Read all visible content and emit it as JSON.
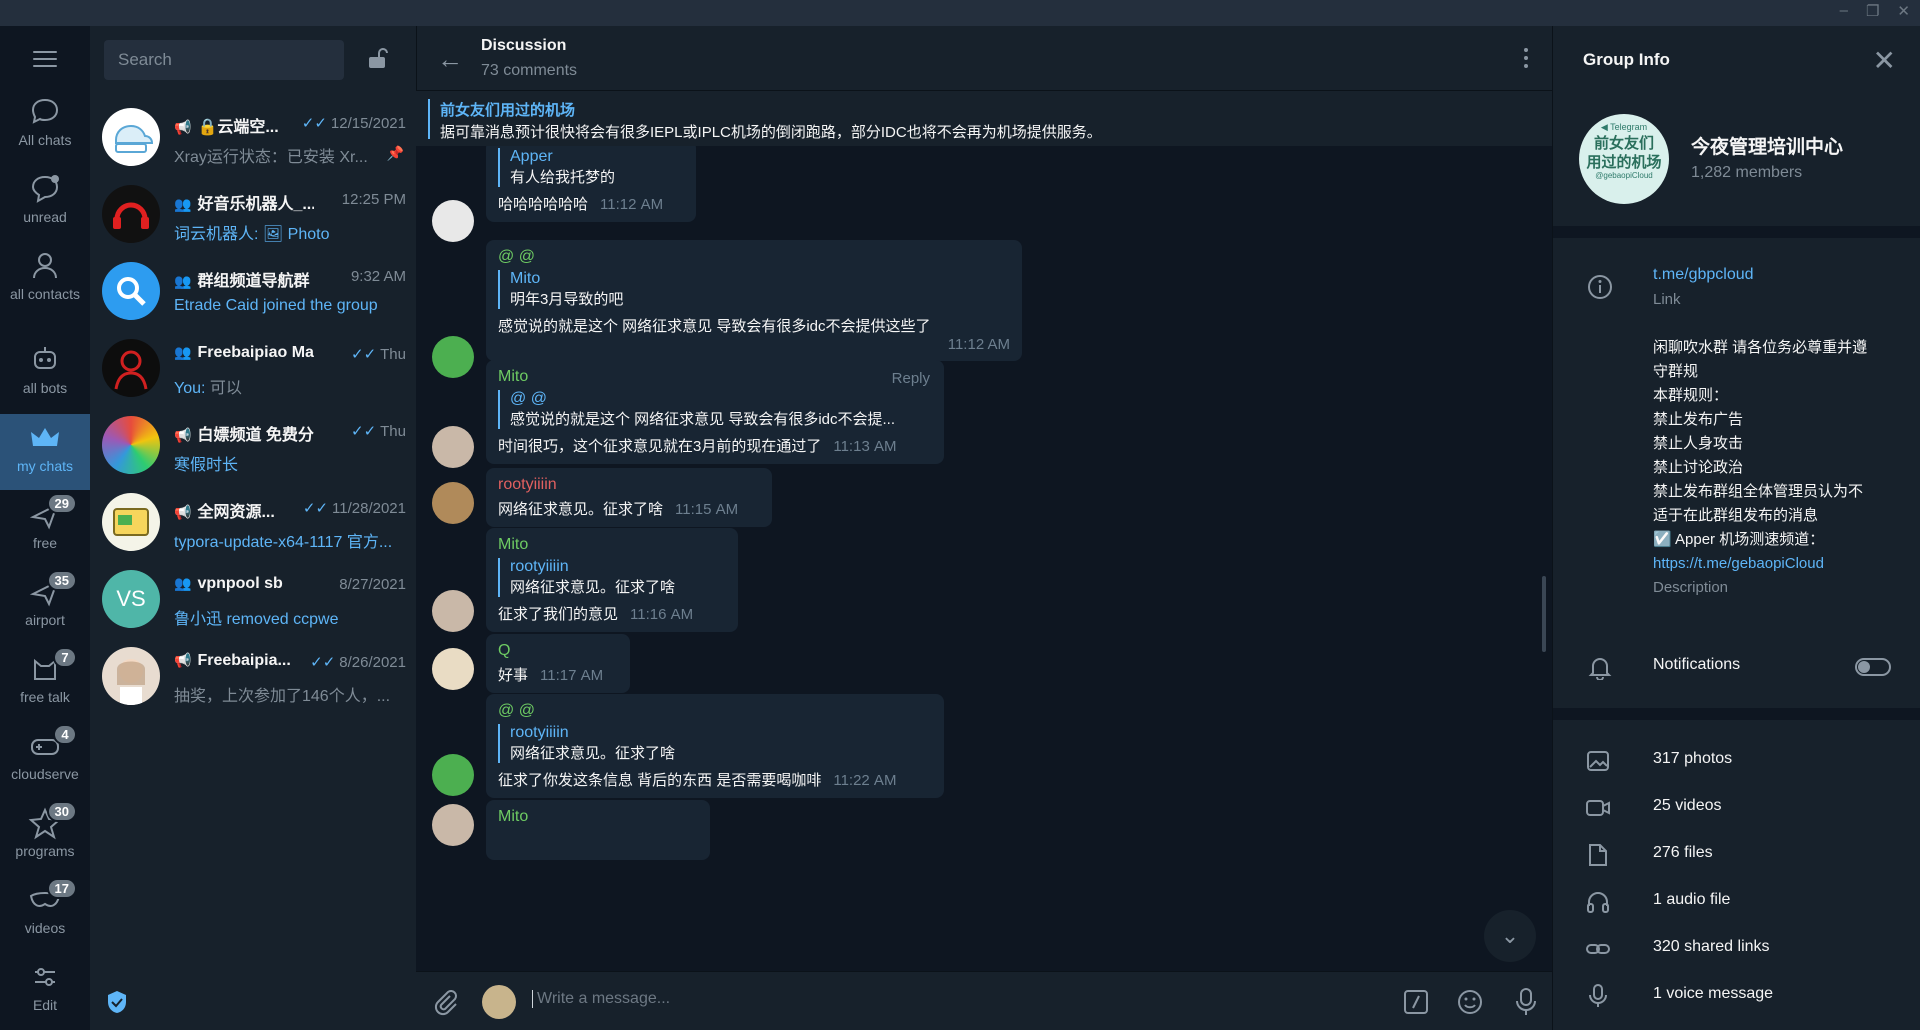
{
  "window": {
    "minimize": "–",
    "restore": "❐",
    "close": "✕"
  },
  "folders": [
    {
      "label": "All chats",
      "icon": "chat-bubbles-icon",
      "badge": ""
    },
    {
      "label": "unread",
      "icon": "chat-bubble-icon",
      "badge": ""
    },
    {
      "label": "all contacts",
      "icon": "person-icon",
      "badge": ""
    },
    {
      "label": "all bots",
      "icon": "bot-icon",
      "badge": ""
    },
    {
      "label": "my chats",
      "icon": "crown-icon",
      "badge": ""
    },
    {
      "label": "free",
      "icon": "plane-icon",
      "badge": "29"
    },
    {
      "label": "airport",
      "icon": "plane-icon",
      "badge": "35"
    },
    {
      "label": "free talk",
      "icon": "cat-icon",
      "badge": "7"
    },
    {
      "label": "cloudserve",
      "icon": "gamepad-icon",
      "badge": "4"
    },
    {
      "label": "programs",
      "icon": "star-icon",
      "badge": "30"
    },
    {
      "label": "videos",
      "icon": "mask-icon",
      "badge": "17"
    },
    {
      "label": "Edit",
      "icon": "sliders-icon",
      "badge": ""
    }
  ],
  "search": {
    "placeholder": "Search"
  },
  "chats": [
    {
      "name": "🔒云端空...",
      "type": "📢",
      "time": "12/15/2021",
      "check": "✓✓",
      "preview_prefix": "",
      "preview": "Xray运行状态：已安装 Xr...",
      "pinned": true
    },
    {
      "name": "好音乐机器人_...",
      "type": "👥",
      "time": "12:25 PM",
      "check": "",
      "preview_prefix": "词云机器人: ",
      "preview": "🖼 Photo",
      "pinned": false
    },
    {
      "name": "群组频道导航群",
      "type": "👥",
      "time": "9:32 AM",
      "check": "",
      "preview_prefix": "Etrade Caid joined the group",
      "preview": "",
      "pinned": false
    },
    {
      "name": "Freebaipiao Man...",
      "type": "👥",
      "time": "Thu",
      "check": "✓✓",
      "preview_prefix": "You: ",
      "preview": "可以",
      "pinned": false
    },
    {
      "name": "白嫖频道 免费分...",
      "type": "📢",
      "time": "Thu",
      "check": "✓✓",
      "preview_prefix": "寒假时长",
      "preview": "",
      "pinned": false
    },
    {
      "name": "全网资源...",
      "type": "📢",
      "time": "11/28/2021",
      "check": "✓✓",
      "preview_prefix": "typora-update-x64-1117 官方...",
      "preview": "",
      "pinned": false
    },
    {
      "name": "vpnpool sb",
      "type": "👥",
      "time": "8/27/2021",
      "check": "",
      "preview_prefix": "鲁小迅 removed ccpwe",
      "preview": "",
      "pinned": false
    },
    {
      "name": "Freebaipia...",
      "type": "📢",
      "time": "8/26/2021",
      "check": "✓✓",
      "preview_prefix": "",
      "preview": "抽奖，上次参加了146个人，...",
      "pinned": false
    }
  ],
  "chat_avatar_initials": "VS",
  "discussion": {
    "title": "Discussion",
    "subtitle": "73 comments",
    "pinned_title": "前女友们用过的机场",
    "pinned_text": "据可靠消息预计很快将会有很多IEPL或IPLC机场的倒闭跑路，部分IDC也将不会再为机场提供服务。"
  },
  "messages": [
    {
      "sender": "",
      "quote_name": "Apper",
      "quote_text": "有人给我托梦的",
      "text": "哈哈哈哈哈哈",
      "time": "11:12 AM",
      "reply": ""
    },
    {
      "sender": "@ @",
      "quote_name": "Mito",
      "quote_text": "明年3月导致的吧",
      "text": "感觉说的就是这个 网络征求意见 导致会有很多idc不会提供这些了",
      "time": "11:12 AM",
      "reply": ""
    },
    {
      "sender": "Mito",
      "quote_name": "@ @",
      "quote_text": "感觉说的就是这个 网络征求意见 导致会有很多idc不会提...",
      "text": "时间很巧，这个征求意见就在3月前的现在通过了",
      "time": "11:13 AM",
      "reply": "Reply"
    },
    {
      "sender": "rootyiiiin",
      "quote_name": "",
      "quote_text": "",
      "text": "网络征求意见。征求了啥",
      "time": "11:15 AM",
      "reply": ""
    },
    {
      "sender": "Mito",
      "quote_name": "rootyiiiin",
      "quote_text": "网络征求意见。征求了啥",
      "text": "征求了我们的意见",
      "time": "11:16 AM",
      "reply": ""
    },
    {
      "sender": "Q",
      "quote_name": "",
      "quote_text": "",
      "text": "好事",
      "time": "11:17 AM",
      "reply": ""
    },
    {
      "sender": "@ @",
      "quote_name": "rootyiiiin",
      "quote_text": "网络征求意见。征求了啥",
      "text": "征求了你发这条信息 背后的东西 是否需要喝咖啡",
      "time": "11:22 AM",
      "reply": ""
    },
    {
      "sender": "Mito",
      "quote_name": "",
      "quote_text": "",
      "text": "",
      "time": "",
      "reply": ""
    }
  ],
  "composer": {
    "placeholder": "Write a message...",
    "cmd": "/"
  },
  "info": {
    "title": "Group Info",
    "avatar_line1": "◀ Telegram",
    "avatar_line2": "前女友们",
    "avatar_line3": "用过的机场",
    "avatar_line4": "@gebaopiCloud",
    "group_name": "今夜管理培训中心",
    "members": "1,282 members",
    "link": "t.me/gbpcloud",
    "link_label": "Link",
    "description_lines": [
      "闲聊吹水群 请各位务必尊重并遵",
      "守群规",
      "本群规则：",
      "禁止发布广告",
      "禁止人身攻击",
      "禁止讨论政治",
      "禁止发布群组全体管理员认为不",
      "适于在此群组发布的消息",
      "☑️ Apper 机场测速频道："
    ],
    "description_link": "https://t.me/gebaopiCloud",
    "description_label": "Description",
    "notifications": "Notifications",
    "media": [
      {
        "label": "317 photos",
        "icon": "photo-icon"
      },
      {
        "label": "25 videos",
        "icon": "video-icon"
      },
      {
        "label": "276 files",
        "icon": "file-icon"
      },
      {
        "label": "1 audio file",
        "icon": "headphones-icon"
      },
      {
        "label": "320 shared links",
        "icon": "link-icon"
      },
      {
        "label": "1 voice message",
        "icon": "mic-icon"
      }
    ]
  },
  "colors": {
    "accent": "#5eb5f7",
    "sidebar_bg": "#17212b",
    "chat_bg": "#0e1621",
    "active_folder": "#2b5278",
    "rootyiiiin": "#e06060",
    "green_name": "#6ecb63"
  }
}
